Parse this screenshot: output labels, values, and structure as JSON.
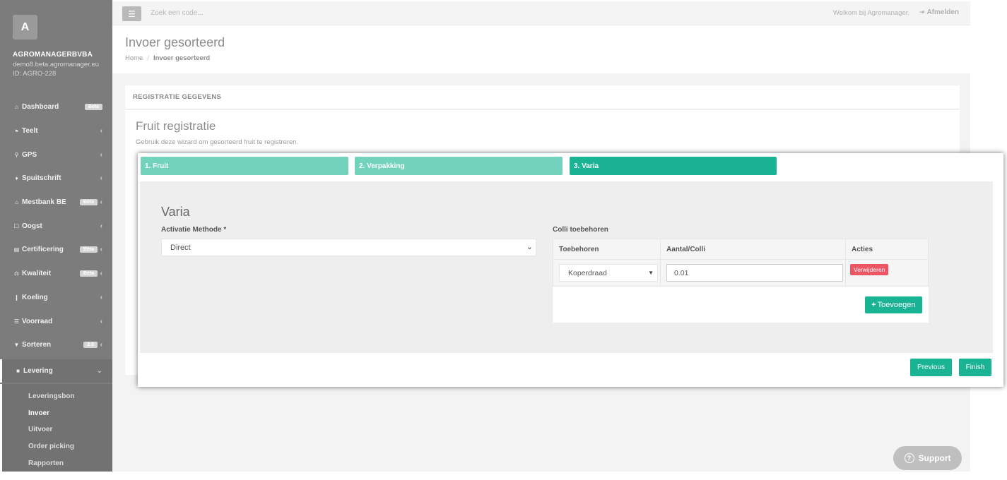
{
  "sidebar": {
    "avatar_letter": "A",
    "company": "AGROMANAGERBVBA",
    "domain": "demo8.beta.agromanager.eu",
    "tenant_id": "ID: AGRO-228",
    "items": [
      {
        "label": "Dashboard",
        "icon": "home-icon",
        "glyph": "⌂",
        "badge": "Beta",
        "arrow": ""
      },
      {
        "label": "Teelt",
        "icon": "leaf-icon",
        "glyph": "❧",
        "badge": "",
        "arrow": "‹"
      },
      {
        "label": "GPS",
        "icon": "map-marker-icon",
        "glyph": "⚲",
        "badge": "",
        "arrow": "‹"
      },
      {
        "label": "Spuitschrift",
        "icon": "drop-icon",
        "glyph": "♦",
        "badge": "",
        "arrow": "‹"
      },
      {
        "label": "Mestbank BE",
        "icon": "bank-icon",
        "glyph": "⌂",
        "badge": "Bèta",
        "arrow": "‹"
      },
      {
        "label": "Oogst",
        "icon": "basket-icon",
        "glyph": "☐",
        "badge": "",
        "arrow": "‹"
      },
      {
        "label": "Certificering",
        "icon": "book-icon",
        "glyph": "▤",
        "badge": "Bèta",
        "arrow": "‹"
      },
      {
        "label": "Kwaliteit",
        "icon": "scale-icon",
        "glyph": "⚖",
        "badge": "Bèta",
        "arrow": "‹"
      },
      {
        "label": "Koeling",
        "icon": "thermometer-icon",
        "glyph": "❙",
        "badge": "",
        "arrow": "‹"
      },
      {
        "label": "Voorraad",
        "icon": "list-icon",
        "glyph": "☰",
        "badge": "",
        "arrow": "‹"
      },
      {
        "label": "Sorteren",
        "icon": "filter-icon",
        "glyph": "▼",
        "badge": "2.0",
        "arrow": "‹"
      }
    ],
    "active_section": {
      "label": "Levering",
      "icon": "truck-icon",
      "glyph": "■",
      "arrow": "⌄"
    },
    "subitems": [
      "Leveringsbon",
      "Invoer",
      "Uitvoer",
      "Order picking",
      "Rapporten"
    ]
  },
  "topbar": {
    "menu_icon": "hamburger-icon",
    "search_placeholder": "Zoek een code...",
    "welcome": "Welkom bij Agromanager.",
    "logout": "Afmelden"
  },
  "heading": {
    "title": "Invoer gesorteerd",
    "breadcrumb_home": "Home",
    "breadcrumb_sep": "/",
    "breadcrumb_current": "Invoer gesorteerd"
  },
  "panel": {
    "title": "REGISTRATIE GEGEVENS",
    "form_title": "Fruit registratie",
    "intro": "Gebruik deze wizard om gesorteerd fruit te registreren."
  },
  "wizard": {
    "steps": [
      "1. Fruit",
      "2. Verpakking",
      "3. Varia"
    ],
    "active_step": 3,
    "section_title": "Varia",
    "activation_label": "Activatie Methode *",
    "activation_value": "Direct",
    "colli_label": "Colli toebehoren",
    "table": {
      "headers": [
        "Toebehoren",
        "Aantal/Colli",
        "Acties"
      ],
      "rows": [
        {
          "accessory": "Koperdraad",
          "amount": "0.01",
          "action": "Verwijderen"
        }
      ]
    },
    "add_button": "Toevoegen",
    "previous_button": "Previous",
    "finish_button": "Finish"
  },
  "support": {
    "label": "Support"
  },
  "colors": {
    "primary": "#1ab394",
    "step_inactive": "#72d3bc",
    "danger": "#ed5565",
    "sidebar": "#7c7c7c"
  }
}
